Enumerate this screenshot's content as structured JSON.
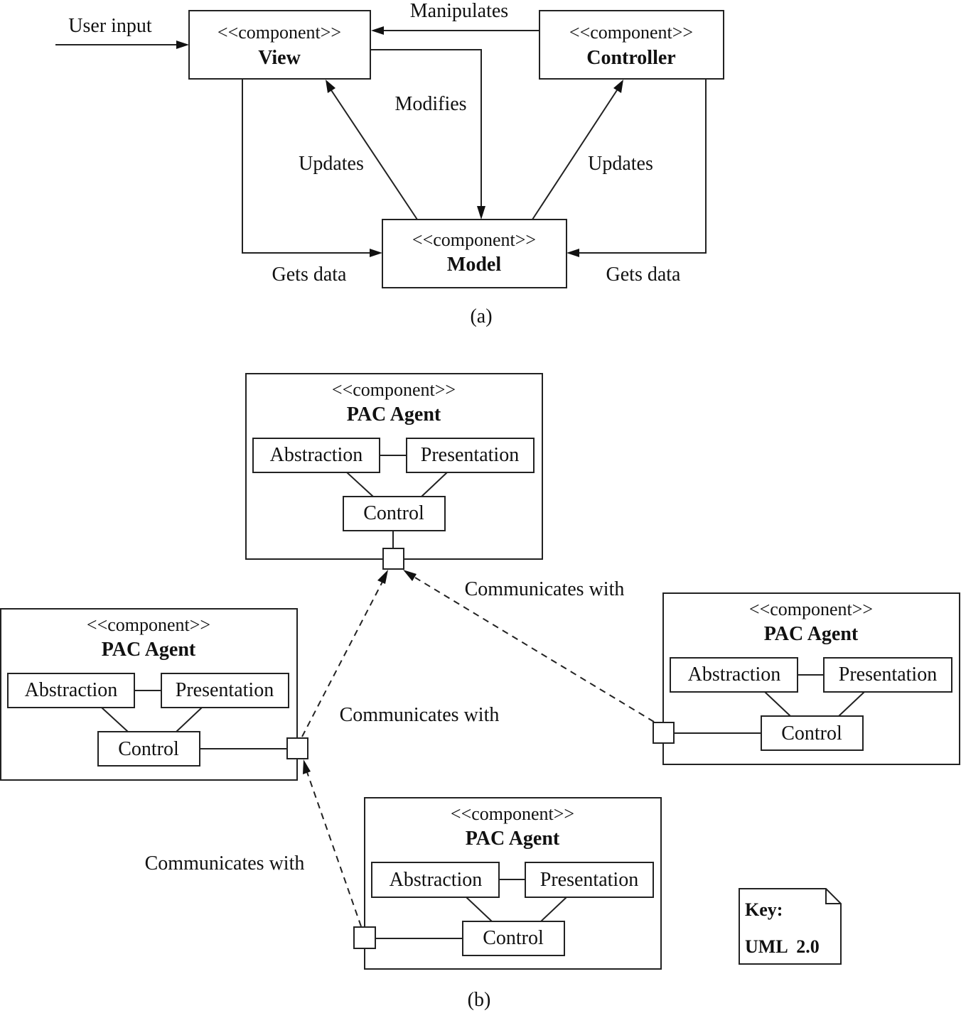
{
  "mvc": {
    "stereotype": "<<component>>",
    "view": "View",
    "controller": "Controller",
    "model": "Model",
    "labels": {
      "user_input": "User input",
      "manipulates": "Manipulates",
      "modifies": "Modifies",
      "updates_view": "Updates",
      "updates_controller": "Updates",
      "gets_data_view": "Gets data",
      "gets_data_controller": "Gets data"
    },
    "caption": "(a)"
  },
  "pac": {
    "agents": [
      {
        "stereotype": "<<component>>",
        "name": "PAC Agent",
        "abstraction": "Abstraction",
        "presentation": "Presentation",
        "control": "Control"
      },
      {
        "stereotype": "<<component>>",
        "name": "PAC Agent",
        "abstraction": "Abstraction",
        "presentation": "Presentation",
        "control": "Control"
      },
      {
        "stereotype": "<<component>>",
        "name": "PAC Agent",
        "abstraction": "Abstraction",
        "presentation": "Presentation",
        "control": "Control"
      },
      {
        "stereotype": "<<component>>",
        "name": "PAC Agent",
        "abstraction": "Abstraction",
        "presentation": "Presentation",
        "control": "Control"
      }
    ],
    "links": [
      "Communicates with",
      "Communicates with",
      "Communicates with"
    ],
    "caption": "(b)"
  },
  "key": {
    "title": "Key:",
    "notation": "UML  2.0"
  }
}
